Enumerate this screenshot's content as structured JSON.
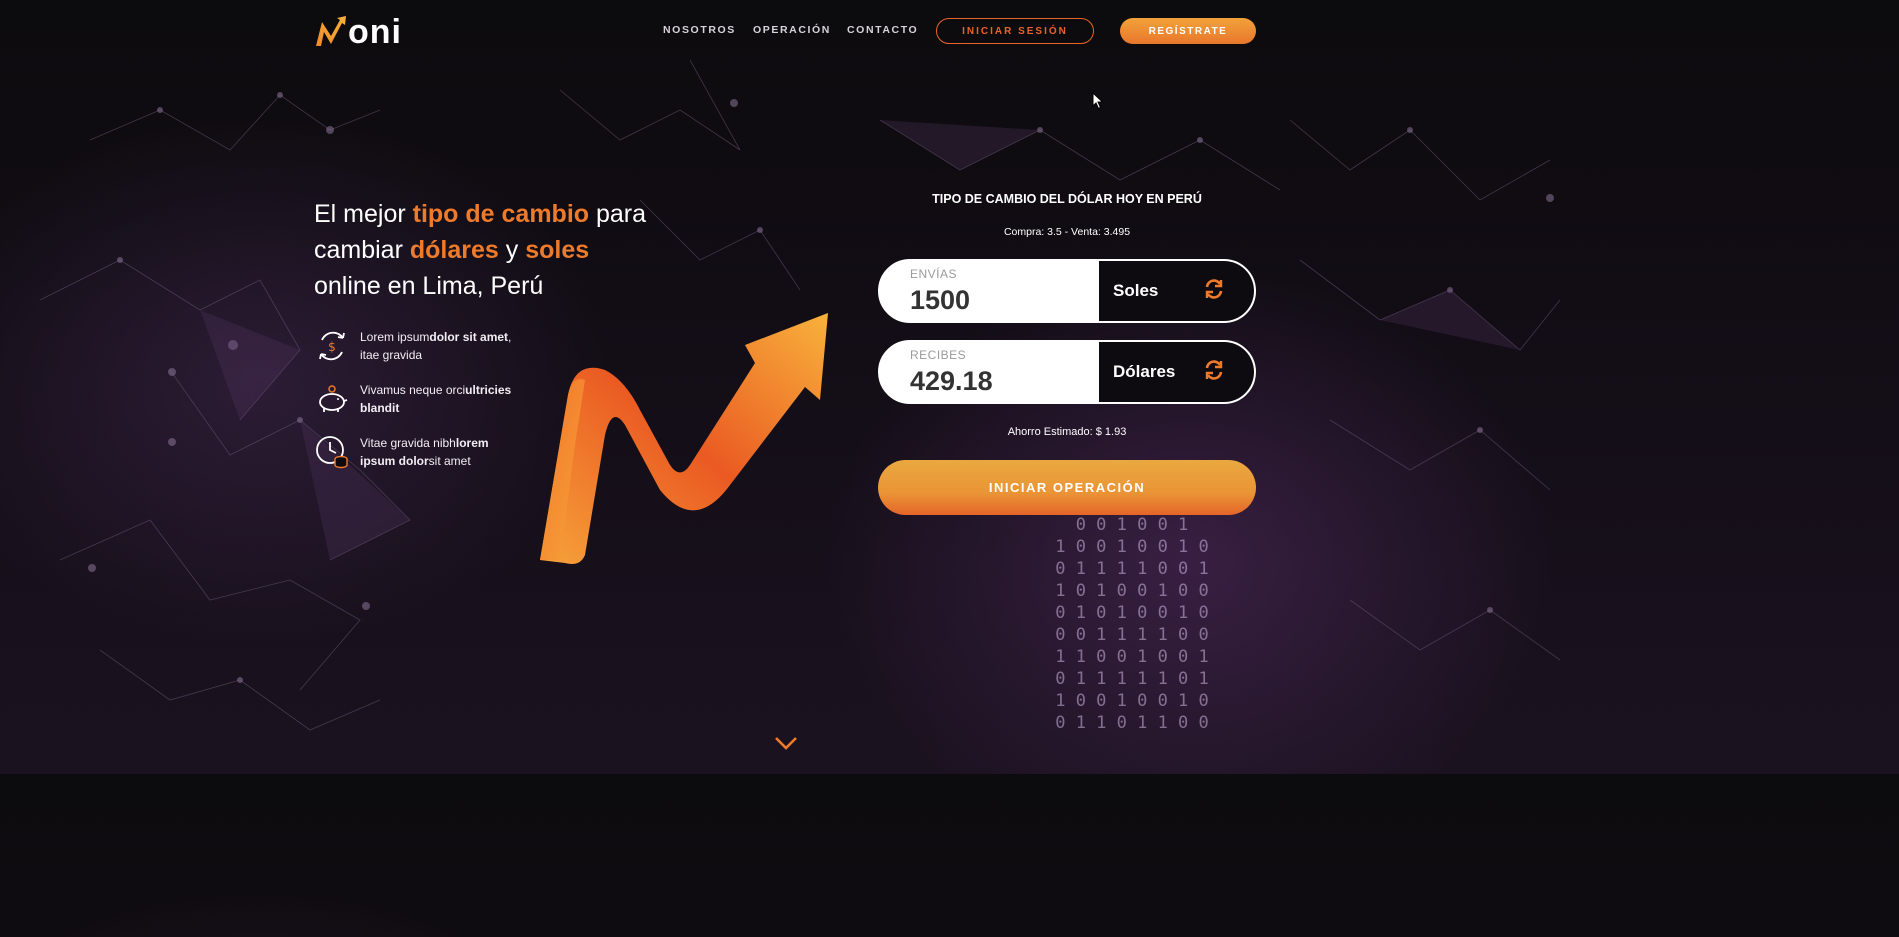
{
  "header": {
    "logo_text_rest": "oni",
    "logo_text_first": "M",
    "nav": [
      "NOSOTROS",
      "OPERACIÓN",
      "CONTACTO"
    ],
    "login_label": "INICIAR SESIÓN",
    "register_label": "REGÍSTRATE"
  },
  "hero": {
    "line1_a": "El mejor ",
    "line1_b": "tipo de cambio",
    "line1_c": " para",
    "line2_a": "cambiar ",
    "line2_b": "dólares",
    "line2_c": " y ",
    "line2_d": "soles",
    "line3": "online en Lima, Perú"
  },
  "features": [
    {
      "icon": "money-exchange-icon",
      "text_a": "Lorem ipsum",
      "text_b": "dolor sit amet",
      "text_c": ", itae gravida"
    },
    {
      "icon": "piggy-bank-icon",
      "text_a": "Vivamus neque orci",
      "text_b": "ultricies blandit",
      "text_c": ""
    },
    {
      "icon": "clock-coins-icon",
      "text_a": "Vitae gravida nibh",
      "text_b": "lorem ipsum dolor",
      "text_c": "sit amet"
    }
  ],
  "converter": {
    "title": "TIPO DE CAMBIO DEL DÓLAR HOY EN PERÚ",
    "rate": "Compra: 3.5 - Venta: 3.495",
    "send": {
      "label": "ENVÍAS",
      "value": "1500",
      "currency": "Soles"
    },
    "receive": {
      "label": "RECIBES",
      "value": "429.18",
      "currency": "Dólares"
    },
    "saving": "Ahorro Estimado: $ 1.93",
    "start_label": "INICIAR OPERACIÓN"
  },
  "colors": {
    "accent": "#ee7a2b",
    "accent_light": "#f2a23a",
    "background": "#120d15"
  }
}
